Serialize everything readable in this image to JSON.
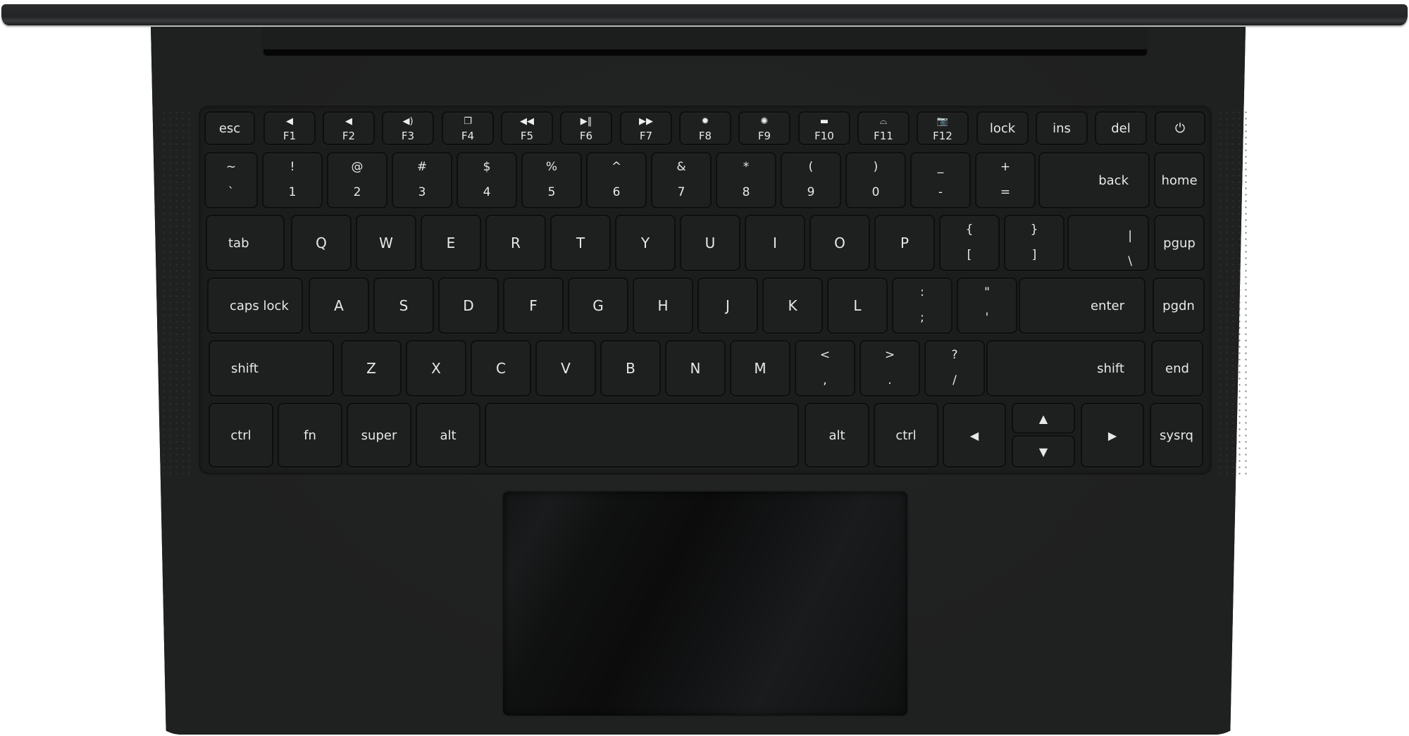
{
  "device": "laptop-keyboard-top-view",
  "colors": {
    "body": "#202121",
    "key": "#1e1f1f",
    "legend": "#e8e8e8",
    "touchpad": "#0e0f0f"
  },
  "rows": {
    "function": [
      {
        "id": "esc",
        "label": "esc"
      },
      {
        "id": "f1",
        "label": "F1",
        "icon": "volume-mute-icon",
        "glyph": "◀"
      },
      {
        "id": "f2",
        "label": "F2",
        "icon": "volume-down-icon",
        "glyph": "◀"
      },
      {
        "id": "f3",
        "label": "F3",
        "icon": "volume-up-icon",
        "glyph": "◀)"
      },
      {
        "id": "f4",
        "label": "F4",
        "icon": "windows-icon",
        "glyph": "❐"
      },
      {
        "id": "f5",
        "label": "F5",
        "icon": "rewind-icon",
        "glyph": "◀◀"
      },
      {
        "id": "f6",
        "label": "F6",
        "icon": "play-pause-icon",
        "glyph": "▶‖"
      },
      {
        "id": "f7",
        "label": "F7",
        "icon": "fast-forward-icon",
        "glyph": "▶▶"
      },
      {
        "id": "f8",
        "label": "F8",
        "icon": "brightness-down-icon",
        "glyph": "✹"
      },
      {
        "id": "f9",
        "label": "F9",
        "icon": "brightness-up-icon",
        "glyph": "✺"
      },
      {
        "id": "f10",
        "label": "F10",
        "icon": "display-icon",
        "glyph": "▬"
      },
      {
        "id": "f11",
        "label": "F11",
        "icon": "keyboard-backlight-icon",
        "glyph": "⌓"
      },
      {
        "id": "f12",
        "label": "F12",
        "icon": "camera-icon",
        "glyph": "📷"
      },
      {
        "id": "lock",
        "label": "lock"
      },
      {
        "id": "ins",
        "label": "ins"
      },
      {
        "id": "del",
        "label": "del"
      },
      {
        "id": "power",
        "label": "⏻",
        "icon": "power-icon"
      }
    ],
    "number": [
      {
        "id": "backtick",
        "up": "~",
        "dn": "`"
      },
      {
        "id": "1",
        "up": "!",
        "dn": "1"
      },
      {
        "id": "2",
        "up": "@",
        "dn": "2"
      },
      {
        "id": "3",
        "up": "#",
        "dn": "3"
      },
      {
        "id": "4",
        "up": "$",
        "dn": "4"
      },
      {
        "id": "5",
        "up": "%",
        "dn": "5"
      },
      {
        "id": "6",
        "up": "^",
        "dn": "6"
      },
      {
        "id": "7",
        "up": "&",
        "dn": "7"
      },
      {
        "id": "8",
        "up": "*",
        "dn": "8"
      },
      {
        "id": "9",
        "up": "(",
        "dn": "9"
      },
      {
        "id": "0",
        "up": ")",
        "dn": "0"
      },
      {
        "id": "minus",
        "up": "_",
        "dn": "-"
      },
      {
        "id": "equals",
        "up": "+",
        "dn": "="
      },
      {
        "id": "backspace",
        "label": "back"
      },
      {
        "id": "home",
        "label": "home"
      }
    ],
    "top": [
      {
        "id": "tab",
        "label": "tab"
      },
      {
        "id": "q",
        "label": "Q"
      },
      {
        "id": "w",
        "label": "W"
      },
      {
        "id": "e",
        "label": "E"
      },
      {
        "id": "r",
        "label": "R"
      },
      {
        "id": "t",
        "label": "T"
      },
      {
        "id": "y",
        "label": "Y"
      },
      {
        "id": "u",
        "label": "U"
      },
      {
        "id": "i",
        "label": "I"
      },
      {
        "id": "o",
        "label": "O"
      },
      {
        "id": "p",
        "label": "P"
      },
      {
        "id": "lbracket",
        "up": "{",
        "dn": "["
      },
      {
        "id": "rbracket",
        "up": "}",
        "dn": "]"
      },
      {
        "id": "backslash",
        "up": "|",
        "dn": "\\"
      },
      {
        "id": "pgup",
        "label": "pgup"
      }
    ],
    "home": [
      {
        "id": "capslock",
        "label": "caps lock"
      },
      {
        "id": "a",
        "label": "A"
      },
      {
        "id": "s",
        "label": "S"
      },
      {
        "id": "d",
        "label": "D"
      },
      {
        "id": "f",
        "label": "F"
      },
      {
        "id": "g",
        "label": "G"
      },
      {
        "id": "h",
        "label": "H"
      },
      {
        "id": "j",
        "label": "J"
      },
      {
        "id": "k",
        "label": "K"
      },
      {
        "id": "l",
        "label": "L"
      },
      {
        "id": "semicolon",
        "up": ":",
        "dn": ";"
      },
      {
        "id": "quote",
        "up": "\"",
        "dn": "'"
      },
      {
        "id": "enter",
        "label": "enter"
      },
      {
        "id": "pgdn",
        "label": "pgdn"
      }
    ],
    "bottom": [
      {
        "id": "lshift",
        "label": "shift"
      },
      {
        "id": "z",
        "label": "Z"
      },
      {
        "id": "x",
        "label": "X"
      },
      {
        "id": "c",
        "label": "C"
      },
      {
        "id": "v",
        "label": "V"
      },
      {
        "id": "b",
        "label": "B"
      },
      {
        "id": "n",
        "label": "N"
      },
      {
        "id": "m",
        "label": "M"
      },
      {
        "id": "comma",
        "up": "<",
        "dn": ","
      },
      {
        "id": "period",
        "up": ">",
        "dn": "."
      },
      {
        "id": "slash",
        "up": "?",
        "dn": "/"
      },
      {
        "id": "rshift",
        "label": "shift"
      },
      {
        "id": "end",
        "label": "end"
      }
    ],
    "space": [
      {
        "id": "lctrl",
        "label": "ctrl"
      },
      {
        "id": "fn",
        "label": "fn"
      },
      {
        "id": "super",
        "label": "super"
      },
      {
        "id": "lalt",
        "label": "alt"
      },
      {
        "id": "space",
        "label": ""
      },
      {
        "id": "ralt",
        "label": "alt"
      },
      {
        "id": "rctrl",
        "label": "ctrl"
      },
      {
        "id": "left",
        "label": "◀",
        "icon": "arrow-left-icon"
      },
      {
        "id": "up",
        "label": "▲",
        "icon": "arrow-up-icon"
      },
      {
        "id": "down",
        "label": "▼",
        "icon": "arrow-down-icon"
      },
      {
        "id": "right",
        "label": "▶",
        "icon": "arrow-right-icon"
      },
      {
        "id": "sysrq",
        "label": "sysrq"
      }
    ]
  }
}
